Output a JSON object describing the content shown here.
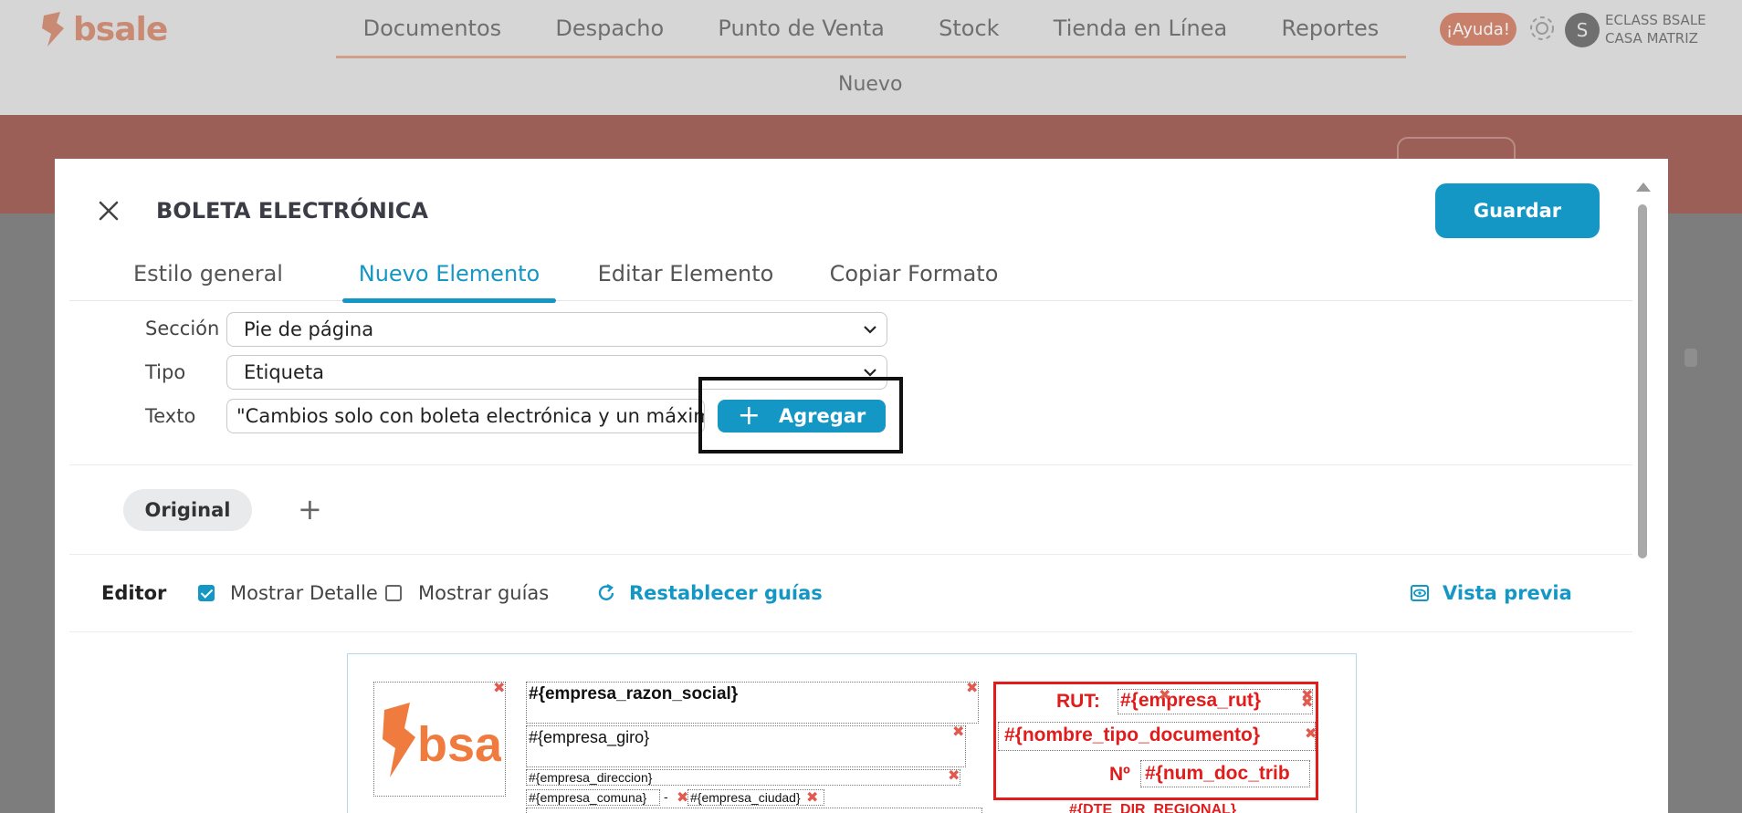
{
  "app": {
    "brand": "bsale",
    "nav": [
      "Documentos",
      "Despacho",
      "Punto de Venta",
      "Stock",
      "Tienda en Línea",
      "Reportes"
    ],
    "subnav": "Nuevo",
    "help": "¡Ayuda!",
    "avatar_letter": "S",
    "account_line1": "ECLASS BSALE",
    "account_line2": "CASA MATRIZ"
  },
  "modal": {
    "title": "BOLETA ELECTRÓNICA",
    "save_label": "Guardar",
    "tabs": [
      {
        "label": "Estilo general",
        "active": false
      },
      {
        "label": "Nuevo Elemento",
        "active": true
      },
      {
        "label": "Editar Elemento",
        "active": false
      },
      {
        "label": "Copiar Formato",
        "active": false
      }
    ],
    "form": {
      "section_label": "Sección",
      "section_value": "Pie de página",
      "type_label": "Tipo",
      "type_value": "Etiqueta",
      "text_label": "Texto",
      "text_value": "\"Cambios solo con boleta electrónica y un máximo d",
      "add_label": "Agregar"
    },
    "version_pill": "Original",
    "editor": {
      "label": "Editor",
      "show_detail_label": "Mostrar Detalle",
      "show_detail_checked": true,
      "show_guides_label": "Mostrar guías",
      "show_guides_checked": false,
      "reset_guides_label": "Restablecer guías",
      "preview_label": "Vista previa"
    },
    "document": {
      "logo_text": "bsale",
      "razon_social": "#{empresa_razon_social}",
      "giro": "#{empresa_giro}",
      "direccion": "#{empresa_direccion}",
      "comuna": "#{empresa_comuna}",
      "dash": "-",
      "ciudad": "#{empresa_ciudad}",
      "rut_label": "RUT:",
      "rut_value": "#{empresa_rut}",
      "tipo_documento": "#{nombre_tipo_documento}",
      "num_label": "Nº",
      "num_value": "#{num_doc_trib",
      "dir_regional": "#{DTE_DIR_REGIONAL}"
    }
  },
  "colors": {
    "accent": "#1597c6",
    "doc_red": "#e21b1b",
    "brand_orange": "#f07b3f"
  }
}
